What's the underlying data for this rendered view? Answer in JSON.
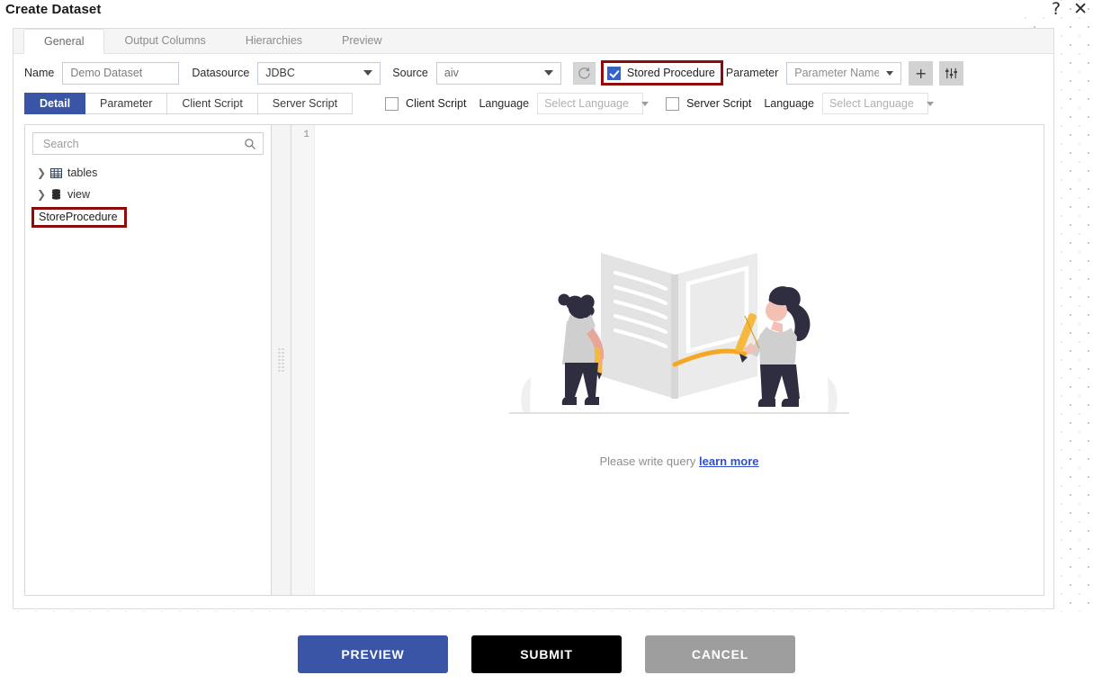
{
  "window": {
    "title": "Create Dataset",
    "help_icon": "help-icon",
    "help_glyph": "?",
    "close_icon": "close-icon",
    "close_glyph": "✕"
  },
  "top_tabs": [
    {
      "label": "General",
      "active": true
    },
    {
      "label": "Output Columns",
      "active": false
    },
    {
      "label": "Hierarchies",
      "active": false
    },
    {
      "label": "Preview",
      "active": false
    }
  ],
  "general_form": {
    "name_label": "Name",
    "name_value": "Demo Dataset",
    "name_placeholder": "Demo Dataset",
    "datasource_label": "Datasource",
    "datasource_value": "JDBC",
    "source_label": "Source",
    "source_value": "aiv",
    "refresh_icon": "refresh-icon",
    "stored_procedure_label": "Stored Procedure",
    "stored_procedure_checked": true,
    "parameter_label": "Parameter",
    "parameter_name_value": "Parameter Name",
    "add_parameter_label": "+",
    "parameter_settings_icon": "sliders-icon",
    "highlight_color": "#8f0b0b",
    "accent_color": "#3464c8"
  },
  "detail_tabs": [
    {
      "label": "Detail",
      "active": true
    },
    {
      "label": "Parameter",
      "active": false
    },
    {
      "label": "Client Script",
      "active": false
    },
    {
      "label": "Server Script",
      "active": false
    }
  ],
  "script_options": {
    "client_script_label": "Client Script",
    "client_script_checked": false,
    "client_language_label": "Language",
    "client_language_value": "Select Language",
    "server_script_label": "Server Script",
    "server_script_checked": false,
    "server_language_label": "Language",
    "server_language_value": "Select Language"
  },
  "tree_panel": {
    "search_placeholder": "Search",
    "search_value": "",
    "search_icon": "search-icon",
    "items": [
      {
        "label": "tables",
        "icon": "table-grid-icon",
        "expandable": true
      },
      {
        "label": "view",
        "icon": "database-icon",
        "expandable": true
      }
    ],
    "store_procedure_label": "StoreProcedure"
  },
  "editor": {
    "line_numbers": [
      "1"
    ],
    "content": "",
    "empty_text": "Please write query",
    "empty_link": "learn more",
    "illustration": "two-people-writing-in-book-illustration"
  },
  "footer_buttons": [
    {
      "label": "PREVIEW",
      "name": "preview-button",
      "color": "#3a55a5"
    },
    {
      "label": "SUBMIT",
      "name": "submit-button",
      "color": "#000000"
    },
    {
      "label": "CANCEL",
      "name": "cancel-button",
      "color": "#9e9e9e"
    }
  ]
}
